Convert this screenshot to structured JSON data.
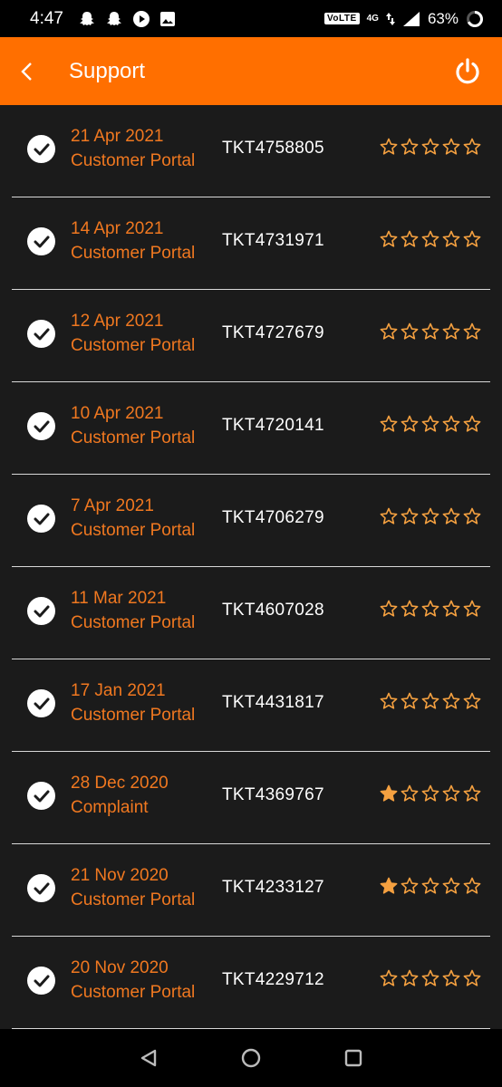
{
  "status_bar": {
    "time": "4:47",
    "network": "VoLTE",
    "signal_type": "4G",
    "battery": "63%",
    "left_icons": [
      "snapchat-icon",
      "snapchat-icon",
      "play-icon",
      "image-icon"
    ]
  },
  "app_bar": {
    "title": "Support",
    "back_icon": "chevron-left-icon",
    "action_icon": "power-icon"
  },
  "colors": {
    "accent": "#ff6f00",
    "text_accent": "#f07820",
    "background": "#1b1b1b",
    "star": "#f4a040"
  },
  "tickets": [
    {
      "date": "21 Apr 2021",
      "category": "Customer Portal",
      "ticket_id": "TKT4758805",
      "rating": 0
    },
    {
      "date": "14 Apr 2021",
      "category": "Customer Portal",
      "ticket_id": "TKT4731971",
      "rating": 0
    },
    {
      "date": "12 Apr 2021",
      "category": "Customer Portal",
      "ticket_id": "TKT4727679",
      "rating": 0
    },
    {
      "date": "10 Apr 2021",
      "category": "Customer Portal",
      "ticket_id": "TKT4720141",
      "rating": 0
    },
    {
      "date": "7 Apr 2021",
      "category": "Customer Portal",
      "ticket_id": "TKT4706279",
      "rating": 0
    },
    {
      "date": "11 Mar 2021",
      "category": "Customer Portal",
      "ticket_id": "TKT4607028",
      "rating": 0
    },
    {
      "date": "17 Jan 2021",
      "category": "Customer Portal",
      "ticket_id": "TKT4431817",
      "rating": 0
    },
    {
      "date": "28 Dec 2020",
      "category": "Complaint",
      "ticket_id": "TKT4369767",
      "rating": 1
    },
    {
      "date": "21 Nov 2020",
      "category": "Customer Portal",
      "ticket_id": "TKT4233127",
      "rating": 1
    },
    {
      "date": "20 Nov 2020",
      "category": "Customer Portal",
      "ticket_id": "TKT4229712",
      "rating": 0
    }
  ],
  "nav_bar": {
    "buttons": [
      "back-triangle-icon",
      "home-circle-icon",
      "recents-square-icon"
    ]
  }
}
